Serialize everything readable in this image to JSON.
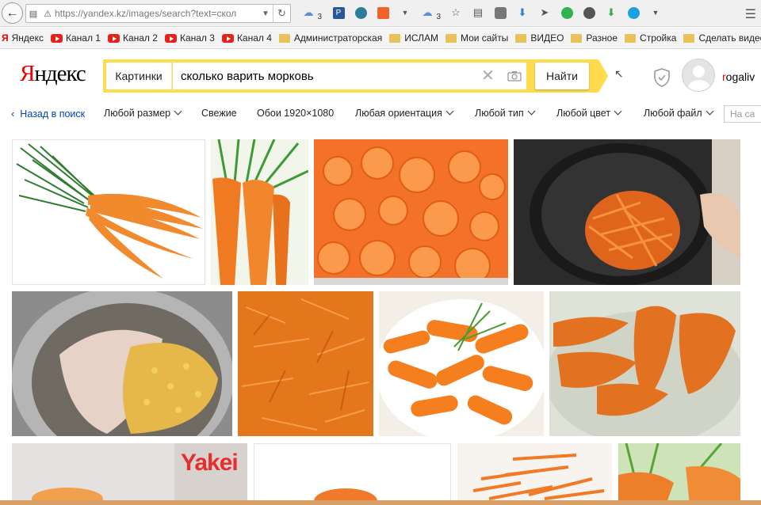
{
  "browser": {
    "url": "https://yandex.kz/images/search?text=скол",
    "toolbar_counts": [
      "3",
      "3"
    ],
    "toolbar_icons": [
      "weather-icon",
      "pocket-p-icon",
      "extension-icon",
      "feed-icon",
      "dropdown-icon",
      "weather-icon-2",
      "star-icon",
      "reading-list-icon",
      "pocket-icon",
      "download-icon",
      "send-icon",
      "refresh-green-icon",
      "chat-icon",
      "download-green-icon",
      "skype-icon",
      "dropdown-icon-2",
      "menu-icon"
    ]
  },
  "bookmarks": [
    {
      "label": "Яндекс",
      "type": "yandex"
    },
    {
      "label": "Канал 1",
      "type": "youtube"
    },
    {
      "label": "Канал 2",
      "type": "youtube"
    },
    {
      "label": "Канал 3",
      "type": "youtube"
    },
    {
      "label": "Канал 4",
      "type": "youtube"
    },
    {
      "label": "Администраторская",
      "type": "folder"
    },
    {
      "label": "ИСЛАМ",
      "type": "folder"
    },
    {
      "label": "Мои сайты",
      "type": "folder"
    },
    {
      "label": "ВИДЕО",
      "type": "folder"
    },
    {
      "label": "Разное",
      "type": "folder"
    },
    {
      "label": "Стройка",
      "type": "folder"
    },
    {
      "label": "Сделать видео",
      "type": "folder"
    }
  ],
  "header": {
    "logo_first": "Я",
    "logo_rest": "ндекс",
    "search_service": "Картинки",
    "search_query": "сколько варить морковь",
    "search_button": "Найти",
    "username_first": "r",
    "username_rest": "ogaliv"
  },
  "filters": {
    "back_link": "Назад в поиск",
    "items": [
      "Любой размер",
      "Свежие",
      "Обои 1920×1080",
      "Любая ориентация",
      "Любой тип",
      "Любой цвет",
      "Любой файл"
    ],
    "site_placeholder": "На са"
  },
  "images": {
    "watermark_text": "Yakei"
  },
  "colors": {
    "yandex_red": "#e00000",
    "search_yellow": "#ffdb4d",
    "link_blue": "#0044bb",
    "carrot_orange": "#f27a2a"
  }
}
